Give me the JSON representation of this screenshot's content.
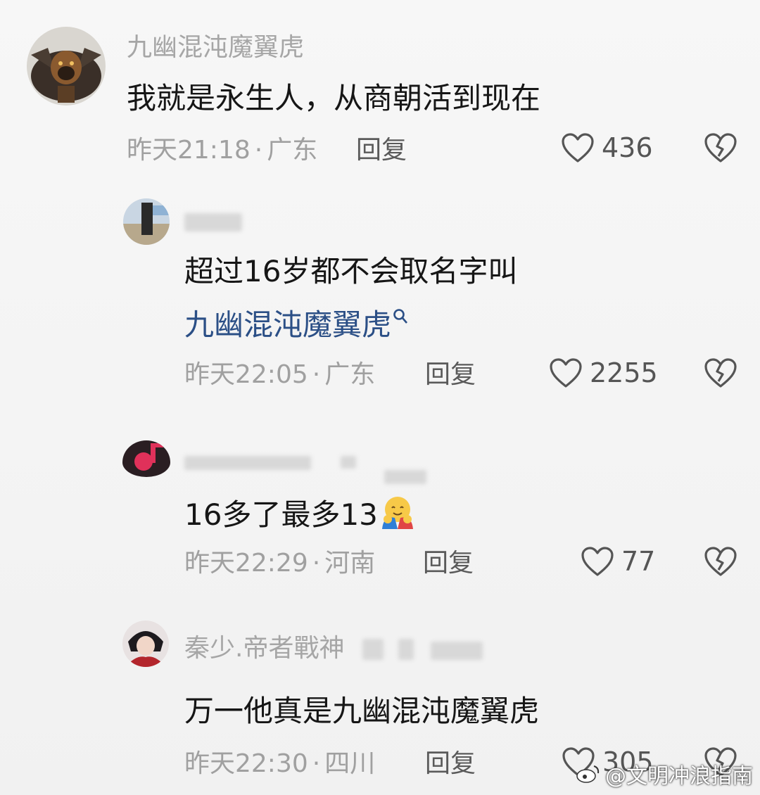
{
  "comments": [
    {
      "username": "九幽混沌魔翼虎",
      "text": "我就是永生人，从商朝活到现在",
      "time": "昨天21:18",
      "location": "广东",
      "reply_label": "回复",
      "likes": "436"
    },
    {
      "username": "",
      "text": "超过16岁都不会取名字叫",
      "mention": "九幽混沌魔翼虎",
      "time": "昨天22:05",
      "location": "广东",
      "reply_label": "回复",
      "likes": "2255"
    },
    {
      "username": "",
      "text": "16多了最多13",
      "time": "昨天22:29",
      "location": "河南",
      "reply_label": "回复",
      "likes": "77"
    },
    {
      "username": "秦少.帝者戰神",
      "text": "万一他真是九幽混沌魔翼虎",
      "time": "昨天22:30",
      "location": "四川",
      "reply_label": "回复",
      "likes": "305"
    }
  ],
  "separator": "·",
  "watermark": "@文明冲浪指南",
  "icons": {
    "like": "heart-outline-icon",
    "dislike": "broken-heart-icon",
    "search": "search-icon",
    "emoji": "hugging-face-emoji"
  }
}
